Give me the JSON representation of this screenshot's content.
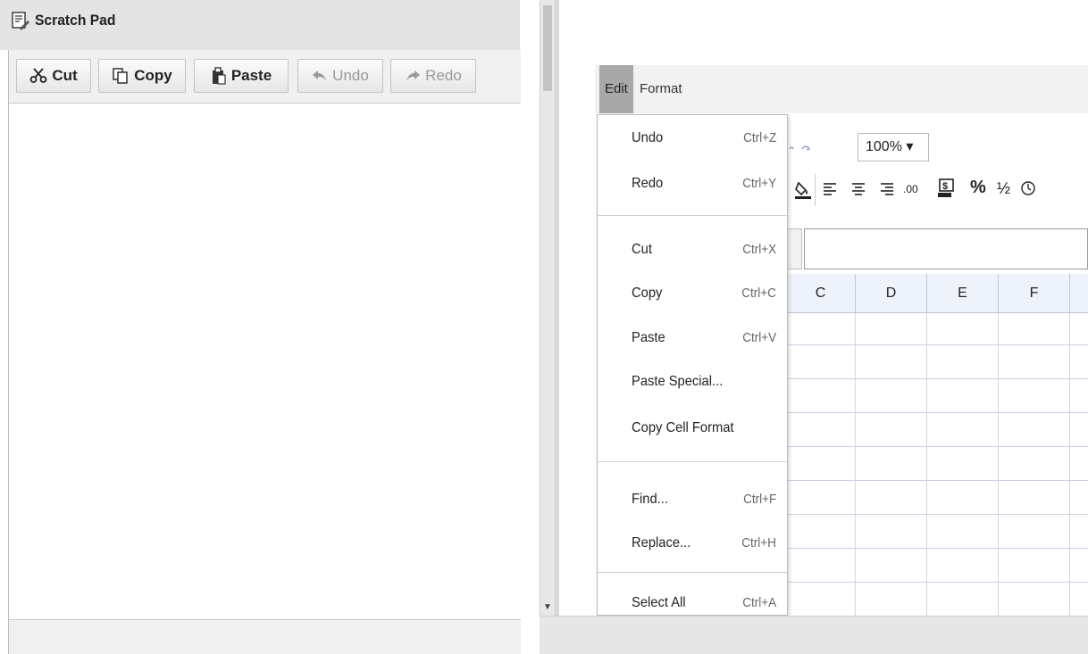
{
  "scratch_pad": {
    "title": "Scratch Pad",
    "toolbar": {
      "cut": "Cut",
      "copy": "Copy",
      "paste": "Paste",
      "undo": "Undo",
      "redo": "Redo"
    },
    "content": ""
  },
  "menubar": {
    "edit": "Edit",
    "format": "Format"
  },
  "edit_menu": {
    "undo": {
      "label": "Undo",
      "shortcut": "Ctrl+Z"
    },
    "redo": {
      "label": "Redo",
      "shortcut": "Ctrl+Y"
    },
    "cut": {
      "label": "Cut",
      "shortcut": "Ctrl+X"
    },
    "copy": {
      "label": "Copy",
      "shortcut": "Ctrl+C"
    },
    "paste": {
      "label": "Paste",
      "shortcut": "Ctrl+V"
    },
    "paste_special": {
      "label": "Paste Special..."
    },
    "copy_cell_format": {
      "label": "Copy Cell Format"
    },
    "find": {
      "label": "Find...",
      "shortcut": "Ctrl+F"
    },
    "replace": {
      "label": "Replace...",
      "shortcut": "Ctrl+H"
    },
    "select_all": {
      "label": "Select All",
      "shortcut": "Ctrl+A"
    }
  },
  "ribbon": {
    "zoom": "100% ▾",
    "decimal": ".00",
    "percent": "%",
    "fraction": "½"
  },
  "grid": {
    "columns": [
      "C",
      "D",
      "E",
      "F"
    ]
  },
  "colors": {
    "menu_active": "#a8a8a8",
    "column_header": "#eef3fb",
    "toolbar_bg": "#f0f0f0"
  }
}
